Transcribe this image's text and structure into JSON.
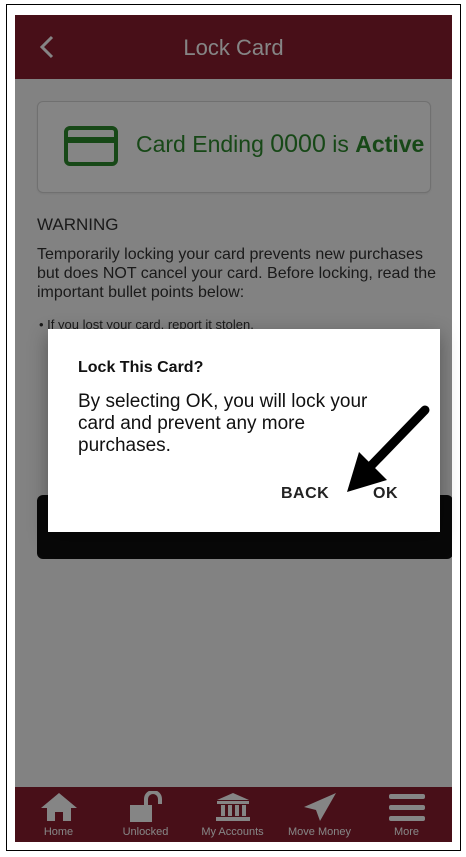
{
  "header": {
    "title": "Lock Card",
    "back_icon": "chevron-left-icon"
  },
  "card_status": {
    "icon": "credit-card-icon",
    "prefix": "Card Ending ",
    "number": "0000",
    "middle": " is ",
    "status": "Active",
    "color": "#2d8a2d"
  },
  "warning": {
    "title": "WARNING",
    "body": "Temporarily locking your card prevents new purchases but does NOT cancel your card. Before locking, read the important bullet points below:",
    "bullets": [
      "If you lost your card, report it stolen."
    ]
  },
  "dialog": {
    "title": "Lock This Card?",
    "message": "By selecting OK, you will lock your card and prevent any more purchases.",
    "back_label": "BACK",
    "ok_label": "OK"
  },
  "tabs": [
    {
      "label": "Home",
      "icon": "home-icon"
    },
    {
      "label": "Unlocked",
      "icon": "unlocked-padlock-icon"
    },
    {
      "label": "My Accounts",
      "icon": "bank-icon"
    },
    {
      "label": "Move Money",
      "icon": "paper-plane-icon"
    },
    {
      "label": "More",
      "icon": "menu-icon"
    }
  ],
  "colors": {
    "brand": "#8a1d2f",
    "active_green": "#2d8a2d"
  }
}
